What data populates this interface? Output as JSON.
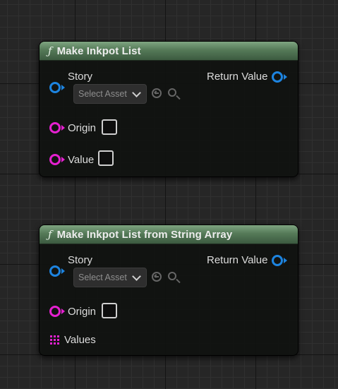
{
  "node1": {
    "title": "Make Inkpot List",
    "func_icon": "ƒ",
    "story_label": "Story",
    "story_value": "Select Asset",
    "return_label": "Return Value",
    "origin_label": "Origin",
    "value_label": "Value"
  },
  "node2": {
    "title": "Make Inkpot List from String Array",
    "func_icon": "ƒ",
    "story_label": "Story",
    "story_value": "Select Asset",
    "return_label": "Return Value",
    "origin_label": "Origin",
    "values_label": "Values"
  },
  "colors": {
    "object_pin": "#1d84e0",
    "string_pin": "#e520d0",
    "header_green": "#557a58"
  }
}
